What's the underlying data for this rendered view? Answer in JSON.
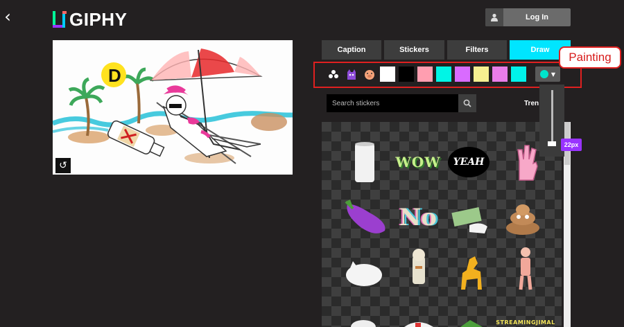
{
  "header": {
    "back_icon": "chevron-left-icon",
    "logo_text": "GIPHY",
    "login_label": "Log In",
    "login_icon": "user-icon"
  },
  "tabs": [
    {
      "label": "Caption",
      "active": false
    },
    {
      "label": "Stickers",
      "active": false
    },
    {
      "label": "Filters",
      "active": false
    },
    {
      "label": "Draw",
      "active": true
    }
  ],
  "draw_tools": {
    "sticker_icons": [
      "pokeball-icon",
      "purple-cat-icon",
      "pig-icon"
    ],
    "swatches": [
      "#ffffff",
      "#000000",
      "#ff9eb0",
      "#00f5e6",
      "#d96bff",
      "#f6ef90",
      "#e97de8",
      "#00f2ea"
    ],
    "picker_color": "#00e5cc",
    "brush_size_label": "22px"
  },
  "annotation": {
    "callout_label": "Painting"
  },
  "search": {
    "placeholder": "Search stickers",
    "trending_label": "Tren"
  },
  "stickers": {
    "wow_text": "WOW",
    "yeah_text": "YEAH",
    "no_text": "No",
    "streaming_text": "STREAMINGJIMAL"
  },
  "canvas": {
    "letter": "D"
  },
  "colors": {
    "accent": "#00e5ff",
    "highlight": "#e02020"
  }
}
